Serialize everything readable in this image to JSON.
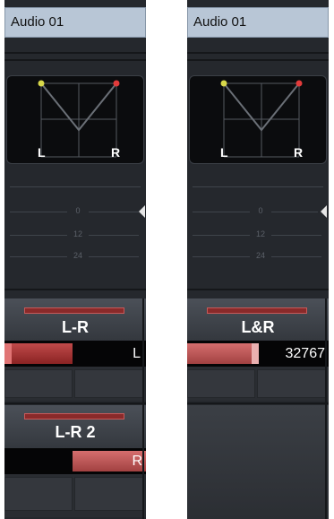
{
  "channels": [
    {
      "name": "Audio 01",
      "panner": {
        "left_label": "L",
        "right_label": "R"
      },
      "meter_scale": [
        "0",
        "12",
        "24"
      ],
      "routing": [
        {
          "label": "L-R",
          "value": "L",
          "fill": 0.48
        },
        {
          "label": "L-R 2",
          "value": "R",
          "fill": 0.48
        }
      ]
    },
    {
      "name": "Audio 01",
      "panner": {
        "left_label": "L",
        "right_label": "R"
      },
      "meter_scale": [
        "0",
        "12",
        "24"
      ],
      "routing": [
        {
          "label": "L&R",
          "value": "32767",
          "fill": 0.5
        }
      ]
    }
  ],
  "colors": {
    "title_bg": "#b8c6d6",
    "strip_bg": "#25282d",
    "routing_bar": "#c04a4a",
    "routing_bar_light": "#d56e6e",
    "panner_left_dot": "#d8d84a",
    "panner_right_dot": "#e23b3b"
  }
}
